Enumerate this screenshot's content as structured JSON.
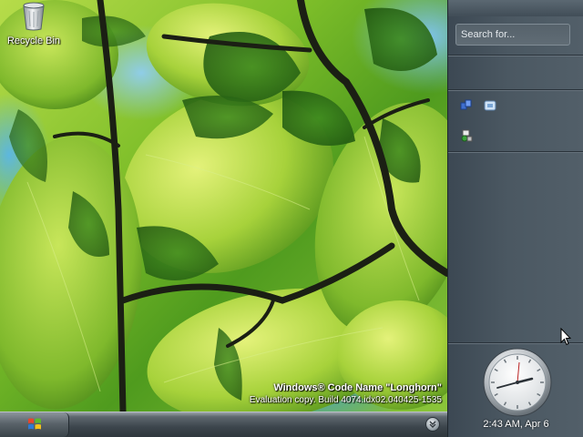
{
  "desktop": {
    "recycle_bin_label": "Recycle Bin",
    "watermark_title": "Windows® Code Name \"Longhorn\"",
    "watermark_build": "Evaluation copy. Build 4074.idx02.040425-1535"
  },
  "sidebar": {
    "search_placeholder": "Search for...",
    "tray_icons": [
      "network-icon",
      "device-icon",
      "user-icon"
    ],
    "clock_text": "2:43 AM, Apr 6"
  },
  "taskbar": {
    "start_icon": "windows-logo-icon",
    "chevron_icon": "chevron-down-icon"
  },
  "colors": {
    "sidebar_bg": "#4b5862",
    "taskbar_bg": "#3c454c",
    "leaf_green": "#8cc63a",
    "branch": "#1b1f14"
  }
}
